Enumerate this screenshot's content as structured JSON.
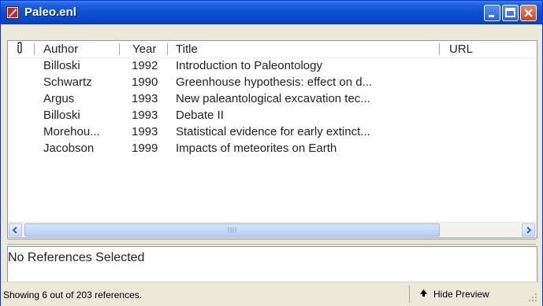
{
  "window": {
    "title": "Paleo.enl"
  },
  "columns": {
    "attachment_icon": "paperclip-icon",
    "author": "Author",
    "year": "Year",
    "title": "Title",
    "url": "URL"
  },
  "references": [
    {
      "author": "Billoski",
      "year": "1992",
      "title": "Introduction to Paleontology"
    },
    {
      "author": "Schwartz",
      "year": "1990",
      "title": "Greenhouse hypothesis: effect on d..."
    },
    {
      "author": "Argus",
      "year": "1993",
      "title": "New paleantological excavation tec..."
    },
    {
      "author": "Billoski",
      "year": "1993",
      "title": "Debate II"
    },
    {
      "author": "Morehou...",
      "year": "1993",
      "title": "Statistical evidence for early extinct..."
    },
    {
      "author": "Jacobson",
      "year": "1999",
      "title": "Impacts of meteorites on Earth"
    }
  ],
  "preview": {
    "text": "No References Selected"
  },
  "status": {
    "text": "Showing 6 out of 203 references.",
    "hide_preview_label": "Hide Preview"
  },
  "colors": {
    "titlebar": "#0a4fd0",
    "close_button": "#c9461f",
    "scroll_thumb": "#b6cdf7"
  }
}
